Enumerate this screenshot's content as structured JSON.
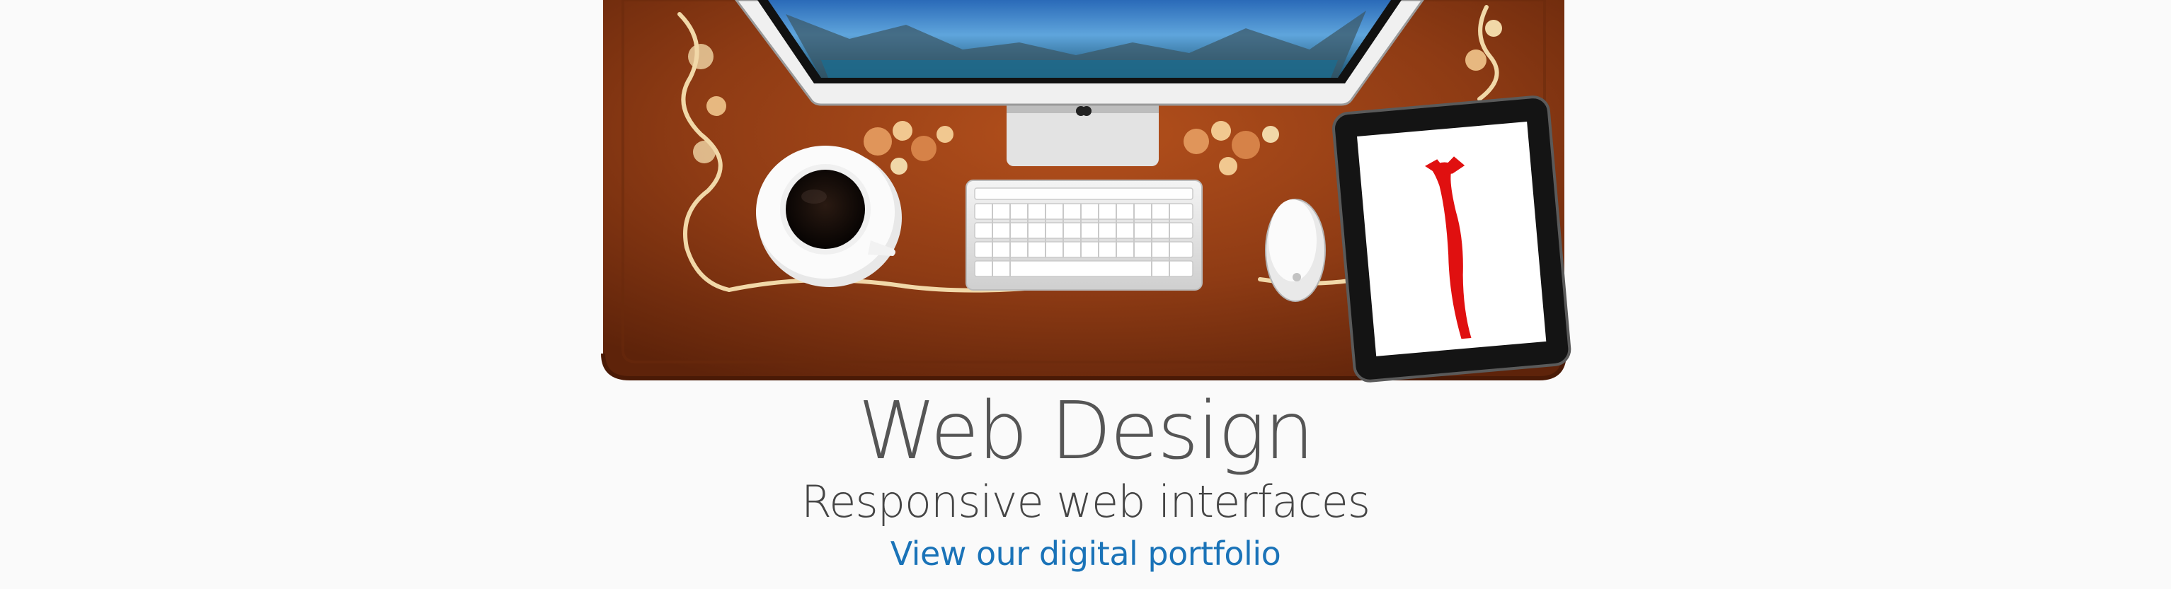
{
  "hero": {
    "title": "Web Design",
    "subtitle": "Responsive web interfaces",
    "link_text": "View our digital portfolio",
    "icons": [
      "monitor-icon",
      "keyboard-icon",
      "mouse-icon",
      "coffee-cup-icon",
      "tablet-icon",
      "apple-logo-icon"
    ]
  },
  "colors": {
    "background": "#fafafa",
    "desk": "#8a3a14",
    "title": "#555555",
    "link": "#1a73b8"
  }
}
